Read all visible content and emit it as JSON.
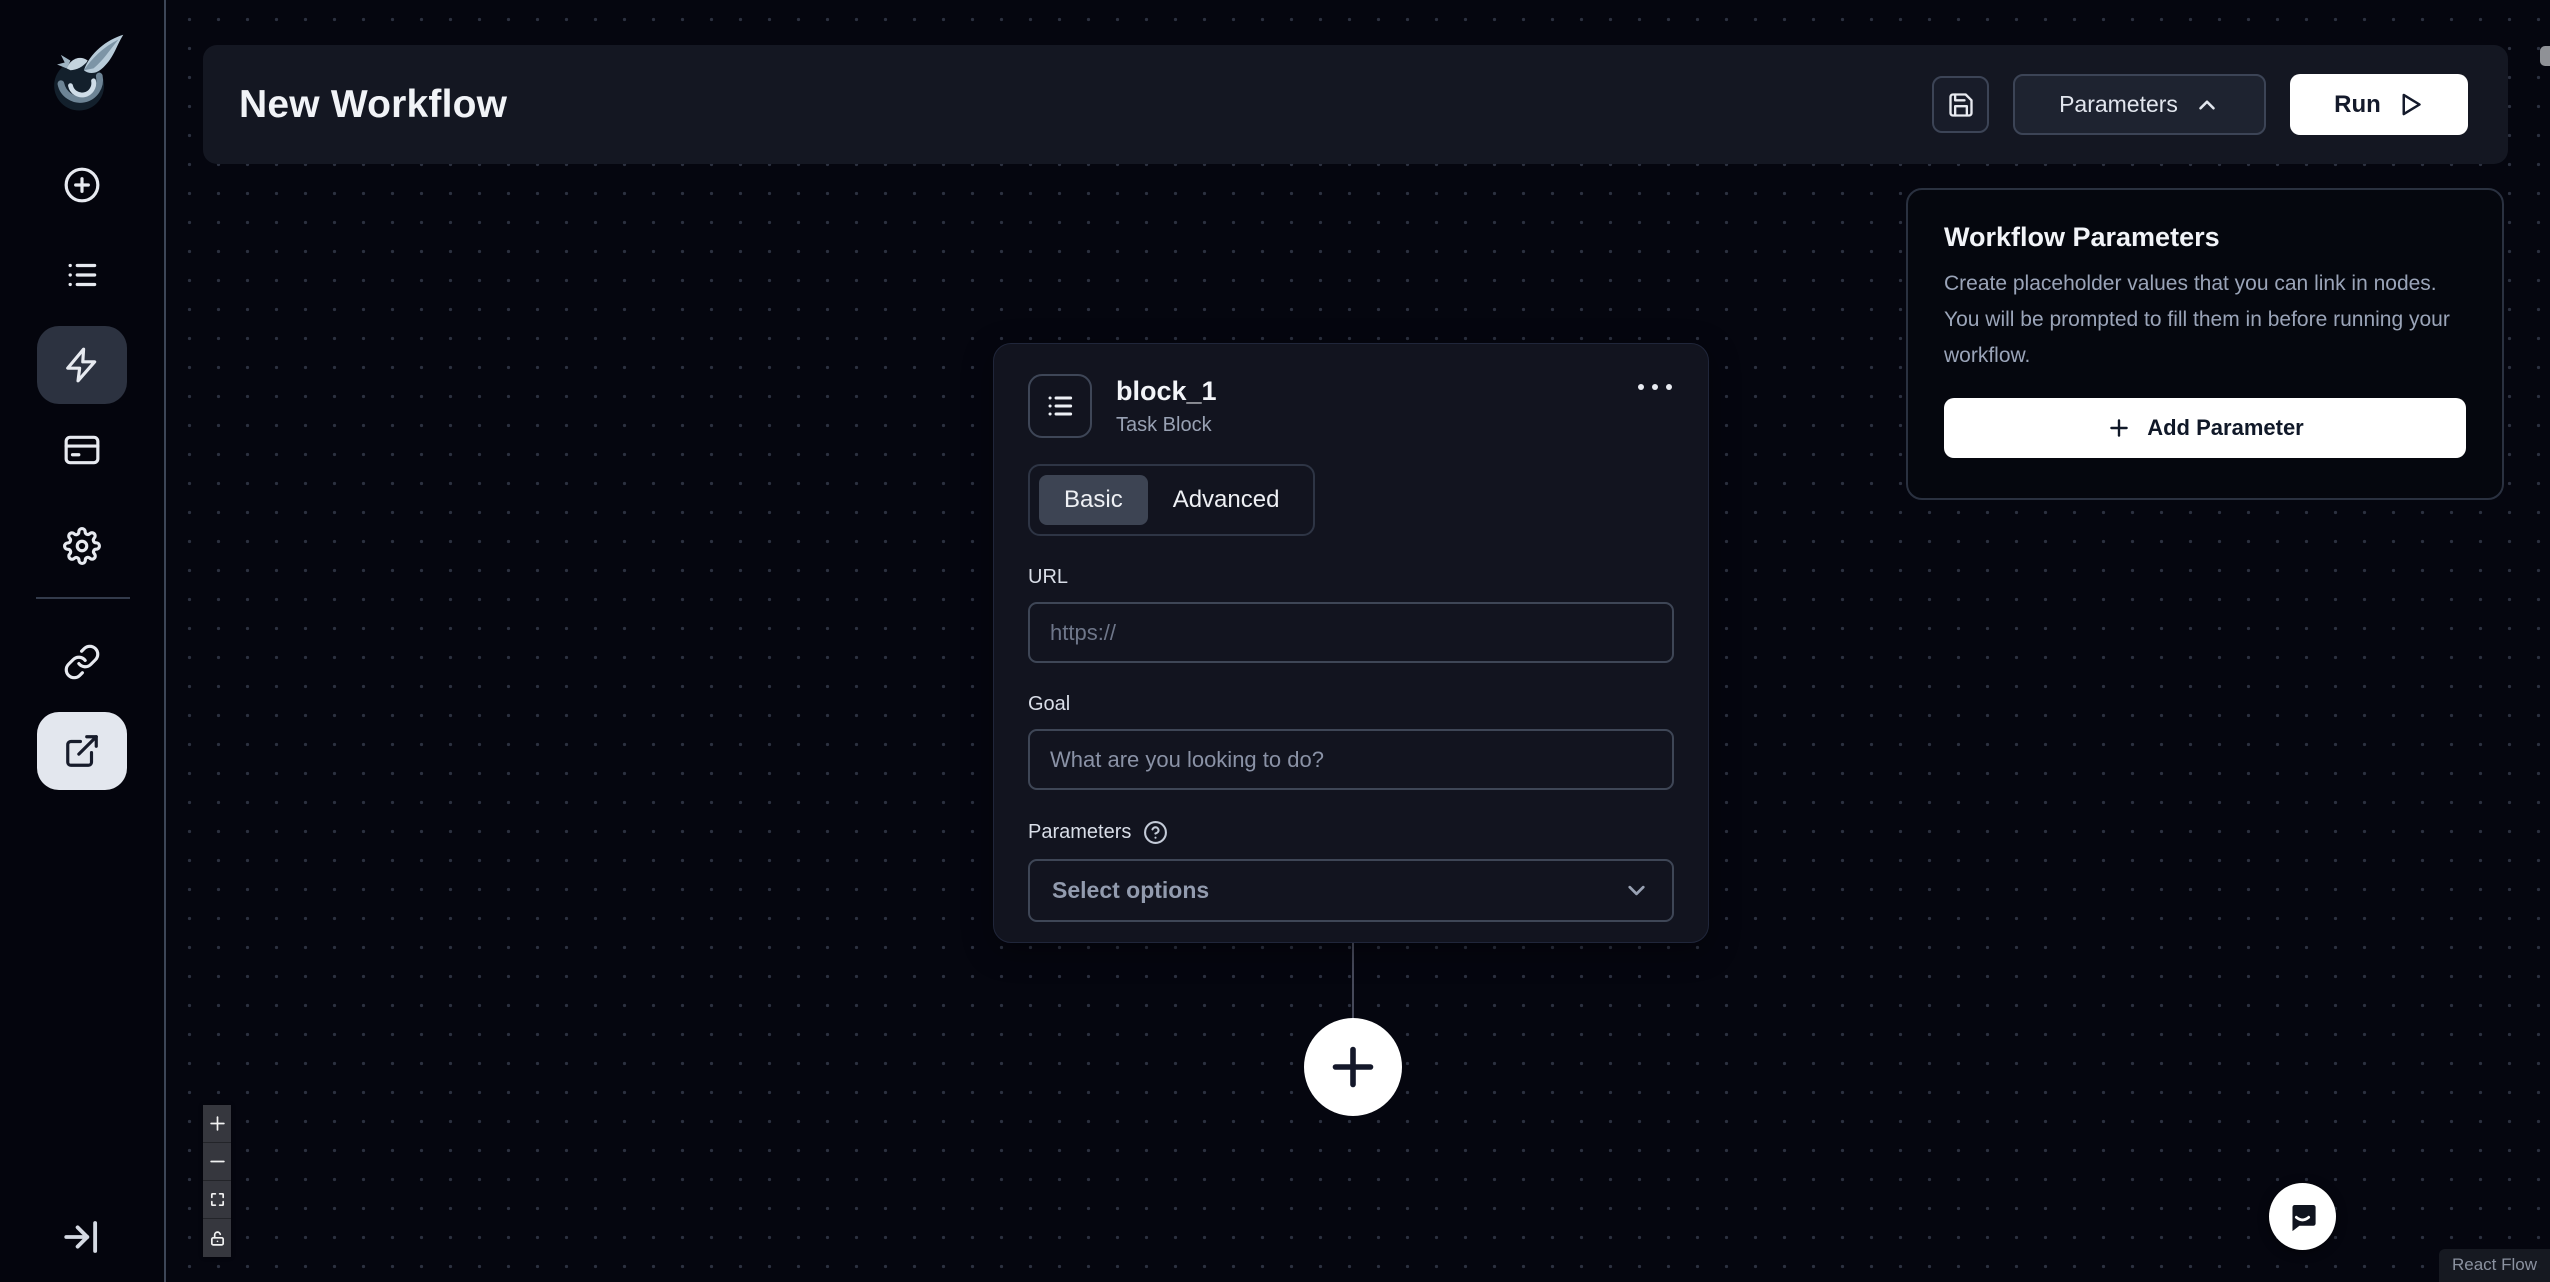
{
  "header": {
    "title": "New Workflow",
    "parameters_label": "Parameters",
    "run_label": "Run"
  },
  "sidebar": {
    "icons": [
      "skyvern-dragon-logo",
      "create-icon",
      "runs-list-icon",
      "workflows-lightning-icon",
      "credentials-card-icon",
      "settings-gear-icon",
      "link-icon",
      "external-link-icon",
      "collapse-sidebar-icon"
    ],
    "active_item": "external-link",
    "highlight_item": "workflows-lightning"
  },
  "node": {
    "title": "block_1",
    "subtitle": "Task Block",
    "tab_basic": "Basic",
    "tab_advanced": "Advanced",
    "url_label": "URL",
    "url_placeholder": "https://",
    "goal_label": "Goal",
    "goal_placeholder": "What are you looking to do?",
    "parameters_label": "Parameters",
    "select_placeholder": "Select options"
  },
  "workflow_parameters_panel": {
    "title": "Workflow Parameters",
    "description": "Create placeholder values that you can link in nodes. You will be prompted to fill them in before running your workflow.",
    "add_button_label": "Add Parameter"
  },
  "canvas": {
    "attribution": "React Flow",
    "controls": [
      "zoom-in",
      "zoom-out",
      "fit-view",
      "lock"
    ]
  },
  "colors": {
    "canvas_bg": "#05060f",
    "header_bg": "#141722",
    "card_bg": "#12141f",
    "border": "#3e4656",
    "accent_light": "#ffffff",
    "text_primary": "#f2f4f8",
    "text_muted": "#98a1b3",
    "active_tab_bg": "#3d4453",
    "sidebar_active_bg": "#e3e7ee"
  }
}
